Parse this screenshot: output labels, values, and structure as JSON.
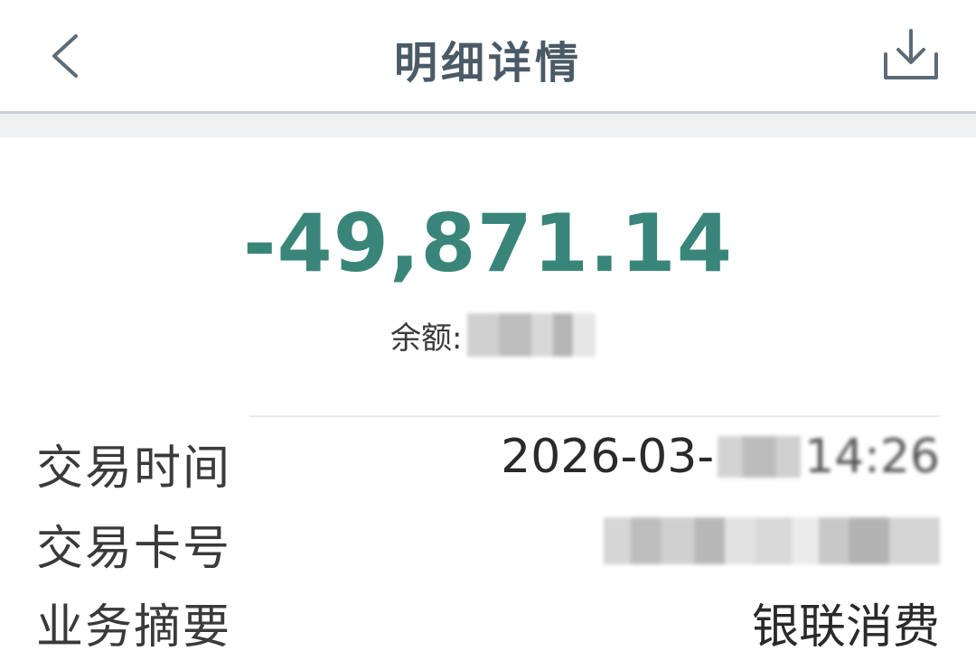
{
  "header": {
    "title": "明细详情",
    "back_icon": "chevron-left",
    "download_icon": "download-tray"
  },
  "transaction": {
    "amount": "-49,871.14",
    "amount_color": "#3a8579",
    "balance_label": "余额:"
  },
  "details": [
    {
      "label": "交易时间",
      "value_prefix": "2026-03-",
      "value_suffix": "14:26"
    },
    {
      "label": "交易卡号"
    },
    {
      "label": "业务摘要",
      "value": "银联消费"
    }
  ]
}
